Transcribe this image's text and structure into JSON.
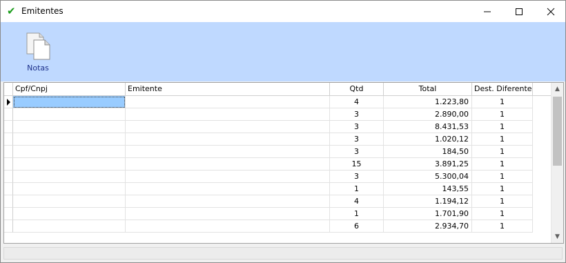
{
  "window": {
    "title": "Emitentes",
    "accent": "#bfd9ff"
  },
  "toolbar": {
    "notas_label": "Notas"
  },
  "grid": {
    "columns": [
      "Cpf/Cnpj",
      "Emitente",
      "Qtd",
      "Total",
      "Dest. Diferentes"
    ],
    "rows": [
      {
        "cpf": "",
        "emitente": "",
        "qtd": "4",
        "total": "1.223,80",
        "dest": "1"
      },
      {
        "cpf": "",
        "emitente": "",
        "qtd": "3",
        "total": "2.890,00",
        "dest": "1"
      },
      {
        "cpf": "",
        "emitente": "",
        "qtd": "3",
        "total": "8.431,53",
        "dest": "1"
      },
      {
        "cpf": "",
        "emitente": "",
        "qtd": "3",
        "total": "1.020,12",
        "dest": "1"
      },
      {
        "cpf": "",
        "emitente": "",
        "qtd": "3",
        "total": "184,50",
        "dest": "1"
      },
      {
        "cpf": "",
        "emitente": "",
        "qtd": "15",
        "total": "3.891,25",
        "dest": "1"
      },
      {
        "cpf": "",
        "emitente": "",
        "qtd": "3",
        "total": "5.300,04",
        "dest": "1"
      },
      {
        "cpf": "",
        "emitente": "",
        "qtd": "1",
        "total": "143,55",
        "dest": "1"
      },
      {
        "cpf": "",
        "emitente": "",
        "qtd": "4",
        "total": "1.194,12",
        "dest": "1"
      },
      {
        "cpf": "",
        "emitente": "",
        "qtd": "1",
        "total": "1.701,90",
        "dest": "1"
      },
      {
        "cpf": "",
        "emitente": "",
        "qtd": "6",
        "total": "2.934,70",
        "dest": "1"
      }
    ]
  }
}
